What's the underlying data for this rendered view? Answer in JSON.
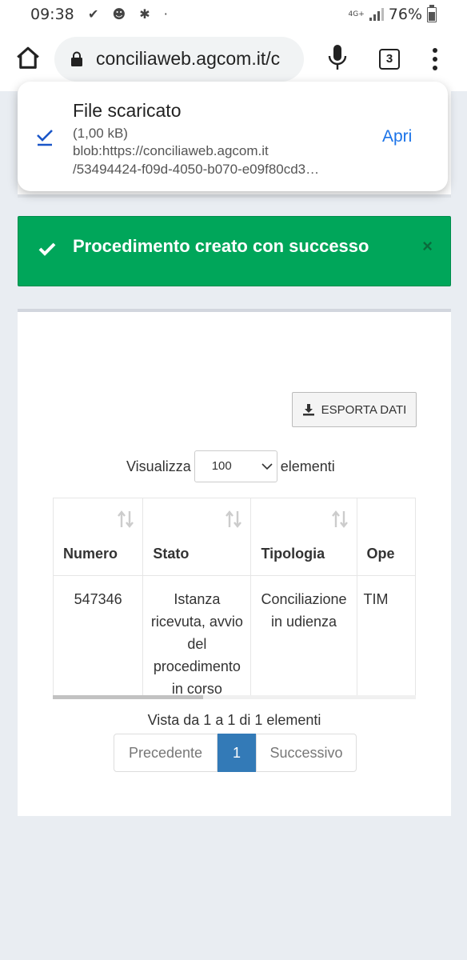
{
  "status_bar": {
    "time": "09:38",
    "network": "4G+",
    "battery": "76%"
  },
  "browser": {
    "url": "conciliaweb.agcom.it/c",
    "tab_count": "3"
  },
  "download": {
    "title": "File scaricato",
    "size": "(1,00 kB)",
    "url_line1": "blob:https://conciliaweb.agcom.it",
    "url_line2": "/53494424-f09d-4050-b070-e09f80cd3…",
    "open_label": "Apri"
  },
  "alert": {
    "message": "Procedimento creato con successo",
    "close": "×",
    "color": "#00a65a"
  },
  "toolbar": {
    "export_label": "ESPORTA DATI"
  },
  "length_menu": {
    "prefix": "Visualizza",
    "selected": "100",
    "suffix": "elementi"
  },
  "table": {
    "headers": [
      "Numero",
      "Stato",
      "Tipologia",
      "Ope"
    ],
    "rows": [
      {
        "numero": "547346",
        "stato": "Istanza ricevuta, avvio del procedimento in corso",
        "tipologia": "Conciliazione in udienza",
        "operatore": "TIM"
      }
    ]
  },
  "pagination": {
    "info": "Vista da 1 a 1 di 1 elementi",
    "prev": "Precedente",
    "current": "1",
    "next": "Successivo",
    "accent": "#337ab7"
  }
}
